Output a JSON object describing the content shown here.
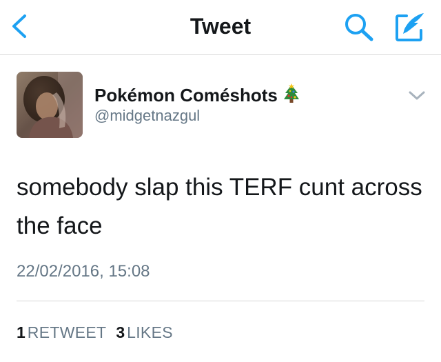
{
  "nav": {
    "title": "Tweet",
    "back_icon": "chevron-left-icon",
    "search_icon": "search-icon",
    "compose_icon": "compose-tweet-icon",
    "accent_color": "#1da1f2"
  },
  "tweet": {
    "author": {
      "display_name": "Pokémon Coméshots",
      "emoji_icon": "christmas-tree-icon",
      "handle": "@midgetnazgul"
    },
    "menu_icon": "chevron-down-icon",
    "text": "somebody slap this TERF cunt across the face",
    "timestamp": "22/02/2016, 15:08",
    "stats": {
      "retweets": {
        "count": "1",
        "label": "RETWEET"
      },
      "likes": {
        "count": "3",
        "label": "LIKES"
      }
    }
  },
  "colors": {
    "text_primary": "#14171a",
    "text_secondary": "#657786",
    "divider": "#d6d6d6"
  }
}
